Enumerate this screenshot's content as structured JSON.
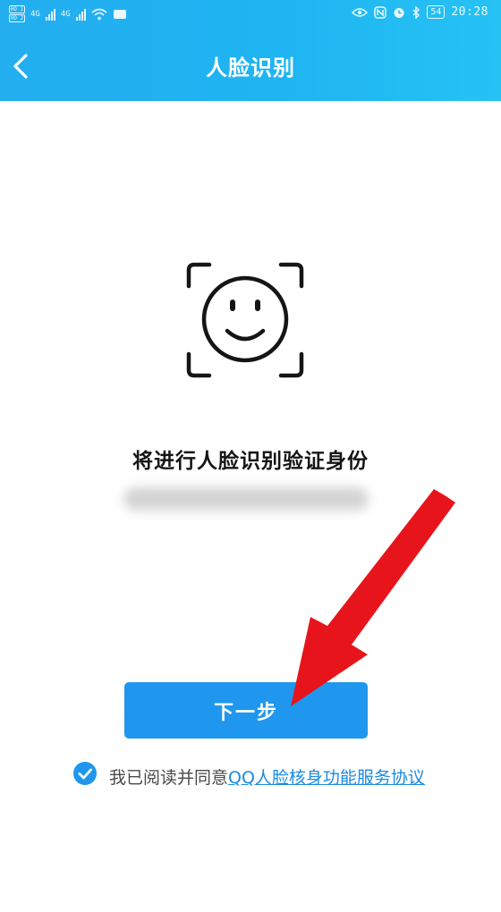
{
  "status_bar": {
    "sim1": "HD 1",
    "sim2": "HD 2",
    "net1": "4G",
    "net2": "4G",
    "battery": "54",
    "time": "20:28"
  },
  "header": {
    "title": "人脸识别",
    "back_icon": "chevron-left-icon"
  },
  "main": {
    "face_icon": "face-scan-icon",
    "verify_text": "将进行人脸识别验证身份"
  },
  "next_button": {
    "label": "下一步"
  },
  "agreement": {
    "prefix": "我已阅读并同意",
    "link": "QQ人脸核身功能服务协议",
    "checked": true
  },
  "colors": {
    "header": "#23aef0",
    "accent": "#1f97ee",
    "link": "#1c8be4",
    "annotation_arrow": "#e8141b"
  }
}
